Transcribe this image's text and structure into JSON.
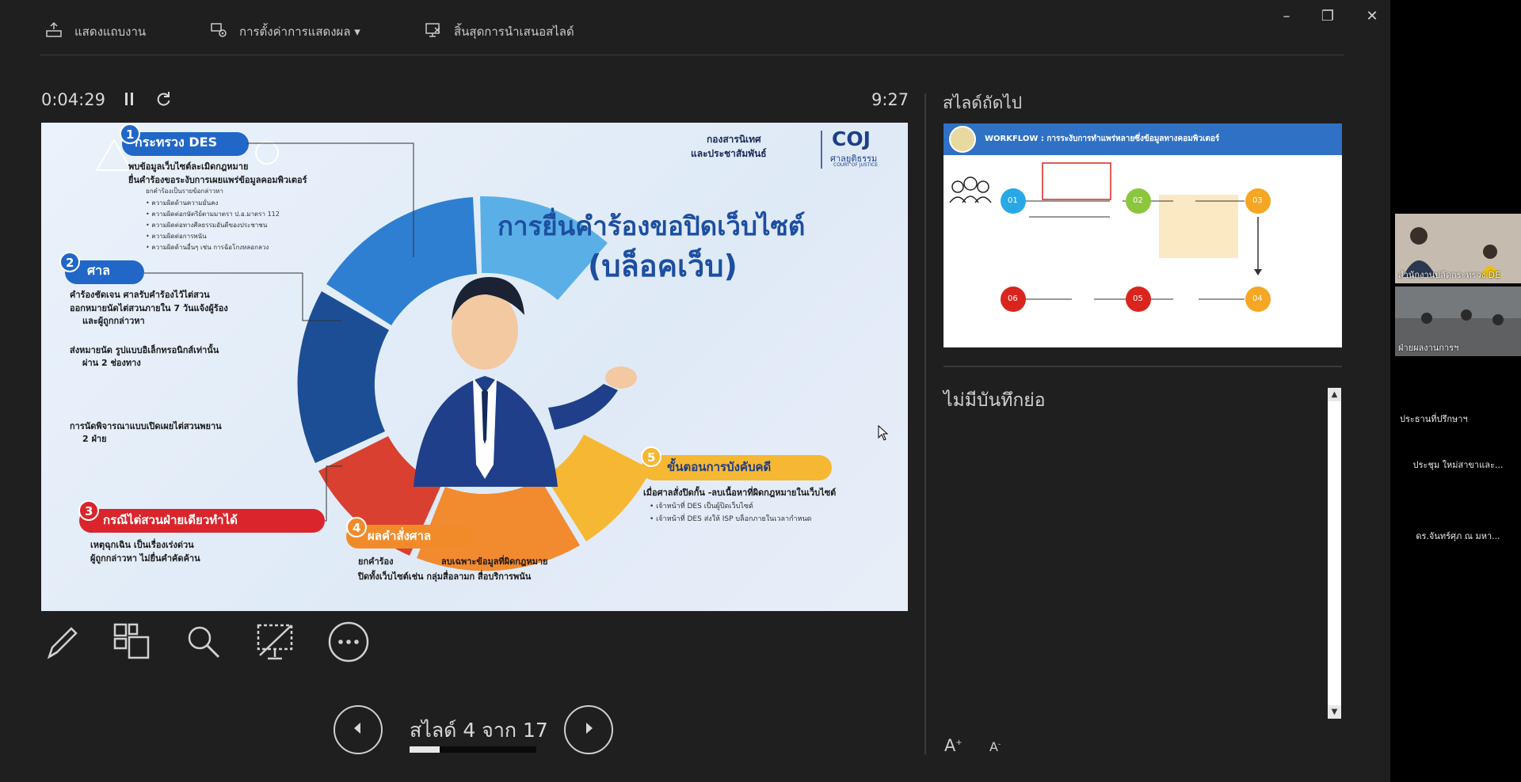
{
  "toolbar": {
    "items": [
      {
        "label": "แสดงแถบงาน",
        "icon": "taskbar-icon"
      },
      {
        "label": "การตั้งค่าการแสดงผล ▾",
        "icon": "display-settings-icon"
      },
      {
        "label": "สิ้นสุดการนำเสนอสไลด์",
        "icon": "end-slideshow-icon"
      }
    ],
    "window_buttons": [
      "–",
      "❐",
      "✕"
    ]
  },
  "presenter": {
    "elapsed_time": "0:04:29",
    "clock": "9:27",
    "slide_counter": "สไลด์ 4 จาก 17",
    "progress_fraction": 0.235,
    "next_slide_label": "สไลด์ถัดไป",
    "notes_text": "ไม่มีบันทึกย่อ",
    "font_increase": "A",
    "font_decrease": "A"
  },
  "current_slide": {
    "title_line1": "การยื่นคำร้องขอปิดเว็บไซต์",
    "title_line2": "(บล็อคเว็บ)",
    "org_line1": "กองสารนิเทศ",
    "org_line2": "และประชาสัมพันธ์",
    "logo_text": "COJ",
    "logo_sub": "ศาลยุติธรรม",
    "logo_sub2": "COURT OF JUSTICE",
    "section1_title": "กระทรวง DES",
    "section1_items": [
      "พบข้อมูลเว็บไซต์ละเมิดกฎหมาย",
      "ยื่นคำร้องขอระงับการเผยแพร่ข้อมูลคอมพิวเตอร์"
    ],
    "section1_sub": [
      "ยกคำร้องเป็นรายข้อกล่าวหา",
      "• ความผิดด้านความมั่นคง",
      "• ความผิดต่อกษัตริย์ตามมาตรา ป.อ.มาตรา 112",
      "• ความผิดต่อทางศีลธรรมอันดีของประชาชน",
      "• ความผิดต่อการพนัน",
      "• ความผิดด้านอื่นๆ เช่น การฉ้อโกงหลอกลวง"
    ],
    "section2_title": "ศาล",
    "section2_items": [
      "คำร้องชัดเจน ศาลรับคำร้องไว้ไต่สวน",
      "ออกหมายนัดไต่สวนภายใน 7 วันแจ้งผู้ร้อง",
      "และผู้ถูกกล่าวหา",
      "ส่งหมายนัด รูปแบบอิเล็กทรอนิกส์เท่านั้น",
      "ผ่าน 2 ช่องทาง",
      "การนัดพิจารณาแบบเปิดเผยไต่สวนพยาน",
      "2 ฝ่าย"
    ],
    "section3_title": "กรณีไต่สวนฝ่ายเดียวทำได้",
    "section3_items": [
      "เหตุฉุกเฉิน เป็นเรื่องเร่งด่วน",
      "ผู้ถูกกล่าวหา ไม่ยื่นคำคัดค้าน"
    ],
    "section4_title": "ผลคำสั่งศาล",
    "section4_items": [
      "ยกคำร้อง",
      "ลบเฉพาะข้อมูลที่ผิดกฎหมาย",
      "ปิดทั้งเว็บไซต์เช่น กลุ่มสื่อลามก สื่อบริการพนัน"
    ],
    "section5_title": "ขั้นตอนการบังคับคดี",
    "section5_head": "เมื่อศาลสั่งปิดกั้น -ลบเนื้อหาที่ผิดกฎหมายในเว็บไซต์",
    "section5_items": [
      "• เจ้าหน้าที่ DES เป็นผู้ปิดเว็บไซต์",
      "• เจ้าหน้าที่ DES ส่งให้ ISP บล็อกภายในเวลากำหนด"
    ]
  },
  "next_slide": {
    "header": "WORKFLOW  :  การระงับการทำแพร่หลายซึ่งข้อมูลทางคอมพิวเตอร์",
    "steps": [
      "01",
      "02",
      "03",
      "04",
      "05",
      "06"
    ]
  },
  "participants": [
    {
      "label": "สำนักงานปลัดกระทรวง DE",
      "type": "video"
    },
    {
      "label": "ฝ่ายผลงานการฯ",
      "type": "video"
    },
    {
      "label": "ประธานที่ปรึกษาฯ",
      "type": "name"
    },
    {
      "label": "ประชุม ใหม่สาขาและ...",
      "type": "name"
    },
    {
      "label": "ดร.จันทร์ศุภ ณ มหา...",
      "type": "name"
    }
  ],
  "colors": {
    "background": "#1f1f1f",
    "slide_title_blue": "#1d4fa0",
    "next_header_blue": "#2f71c4",
    "step_blue": "#29a8e6",
    "step_green": "#8cc63f",
    "step_orange": "#f5a623",
    "step_red": "#d9251d"
  }
}
